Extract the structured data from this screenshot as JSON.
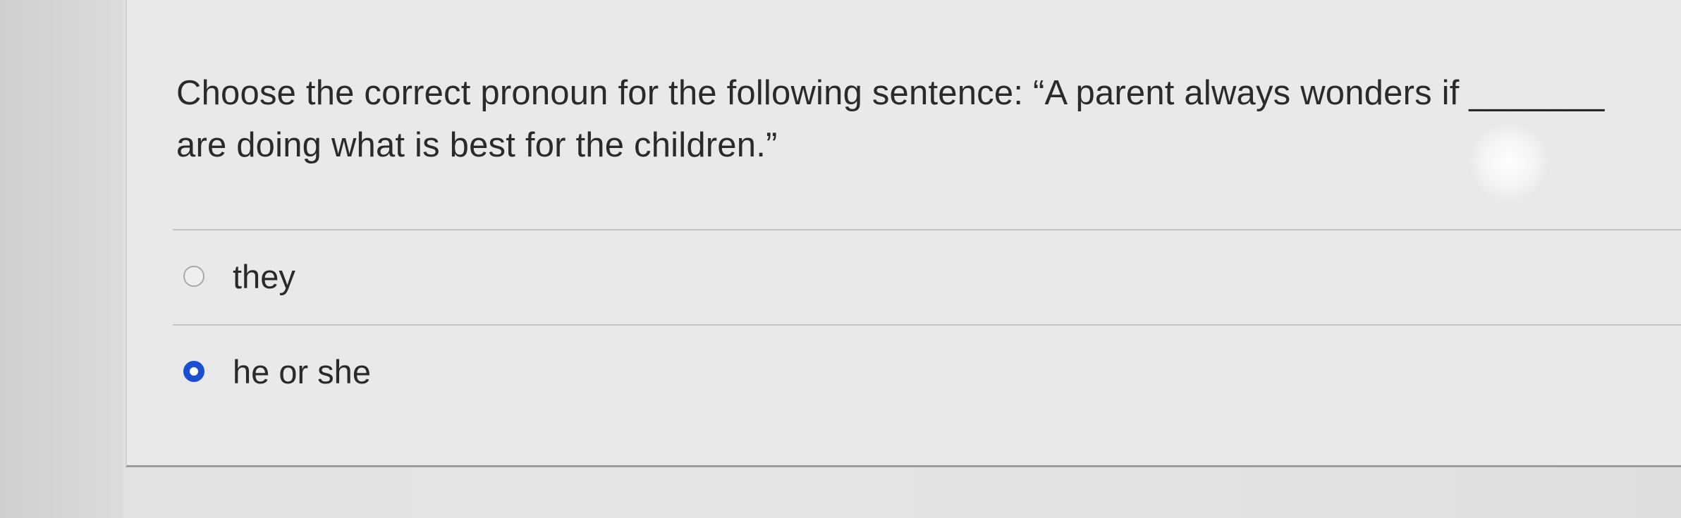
{
  "question": {
    "text": "Choose the correct pronoun for the following sentence: “A parent always wonders if _______ are doing what is best for the children.”"
  },
  "options": [
    {
      "label": "they",
      "selected": false
    },
    {
      "label": "he or she",
      "selected": true
    }
  ],
  "colors": {
    "radio_selected": "#1b4fd1",
    "radio_unselected_border": "#a8a8a8",
    "text": "#2a2a2a"
  }
}
